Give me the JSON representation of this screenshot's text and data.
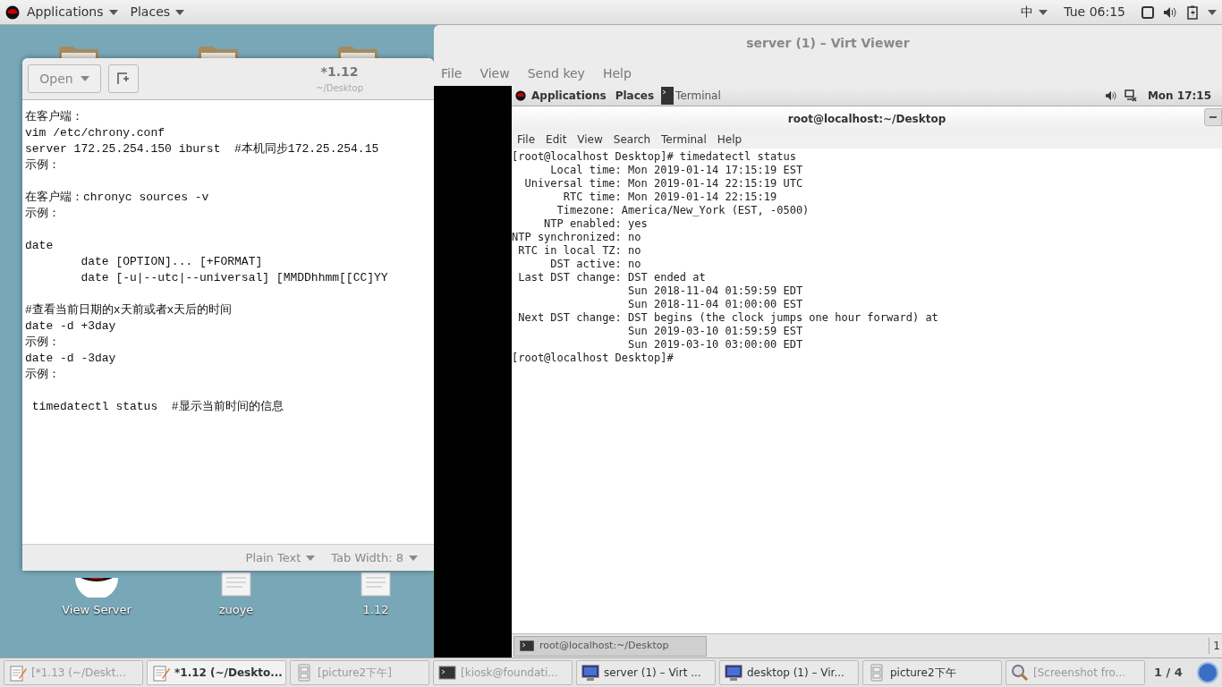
{
  "top_bar": {
    "menus": [
      "Applications",
      "Places"
    ],
    "input_method": "中",
    "clock": "Tue 06:15"
  },
  "desktop_icons": [
    {
      "label": "View Server",
      "kind": "logo"
    },
    {
      "label": "zuoye",
      "kind": "document"
    },
    {
      "label": "1.12",
      "kind": "document"
    }
  ],
  "editor": {
    "open_button": "Open",
    "title": "*1.12",
    "subtitle": "~/Desktop",
    "paragraphs": [
      [
        "在客户端：",
        "vim /etc/chrony.conf",
        "server 172.25.254.150 iburst  #本机同步172.25.254.15",
        "示例："
      ],
      [
        "在客户端：chronyc sources -v",
        "示例："
      ],
      [
        "date",
        "        date [OPTION]... [+FORMAT]",
        "        date [-u|--utc|--universal] [MMDDhhmm[[CC]YY"
      ],
      [
        "#查看当前日期的x天前或者x天后的时间",
        "date -d +3day",
        "示例：",
        "date -d -3day",
        "示例："
      ],
      [
        " timedatectl status  #显示当前时间的信息"
      ]
    ],
    "status": [
      "Plain Text",
      "Tab Width: 8"
    ]
  },
  "viewer": {
    "title": "server (1) – Virt Viewer",
    "menu": [
      "File",
      "View",
      "Send key",
      "Help"
    ],
    "guest": {
      "top_bar": {
        "menus": [
          "Applications",
          "Places"
        ],
        "task": "Terminal",
        "clock": "Mon 17:15"
      },
      "terminal": {
        "title": "root@localhost:~/Desktop",
        "menu": [
          "File",
          "Edit",
          "View",
          "Search",
          "Terminal",
          "Help"
        ],
        "lines": [
          "[root@localhost Desktop]# timedatectl status",
          "      Local time: Mon 2019-01-14 17:15:19 EST",
          "  Universal time: Mon 2019-01-14 22:15:19 UTC",
          "        RTC time: Mon 2019-01-14 22:15:19",
          "       Timezone: America/New_York (EST, -0500)",
          "     NTP enabled: yes",
          "NTP synchronized: no",
          " RTC in local TZ: no",
          "      DST active: no",
          " Last DST change: DST ended at",
          "                  Sun 2018-11-04 01:59:59 EDT",
          "                  Sun 2018-11-04 01:00:00 EST",
          " Next DST change: DST begins (the clock jumps one hour forward) at",
          "                  Sun 2019-03-10 01:59:59 EST",
          "                  Sun 2019-03-10 03:00:00 EDT",
          "[root@localhost Desktop]#"
        ]
      },
      "bottom_task": "root@localhost:~/Desktop",
      "pager": "1"
    }
  },
  "taskbar": {
    "items": [
      {
        "label": "[*1.13 (~/Deskt...",
        "kind": "editor",
        "selected": false,
        "minimized": true
      },
      {
        "label": "*1.12 (~/Deskto...",
        "kind": "editor",
        "selected": true,
        "minimized": false
      },
      {
        "label": "[picture2下午]",
        "kind": "cabinet",
        "selected": false,
        "minimized": true
      },
      {
        "label": "[kiosk@foundati...",
        "kind": "terminal",
        "selected": false,
        "minimized": true
      },
      {
        "label": "server (1) – Virt ...",
        "kind": "monitor",
        "selected": false,
        "minimized": false
      },
      {
        "label": "desktop (1) – Vir...",
        "kind": "monitor",
        "selected": false,
        "minimized": false
      },
      {
        "label": "picture2下午",
        "kind": "cabinet",
        "selected": false,
        "minimized": false
      },
      {
        "label": "[Screenshot fro...",
        "kind": "viewer",
        "selected": false,
        "minimized": true
      }
    ],
    "pager": "1 / 4"
  }
}
